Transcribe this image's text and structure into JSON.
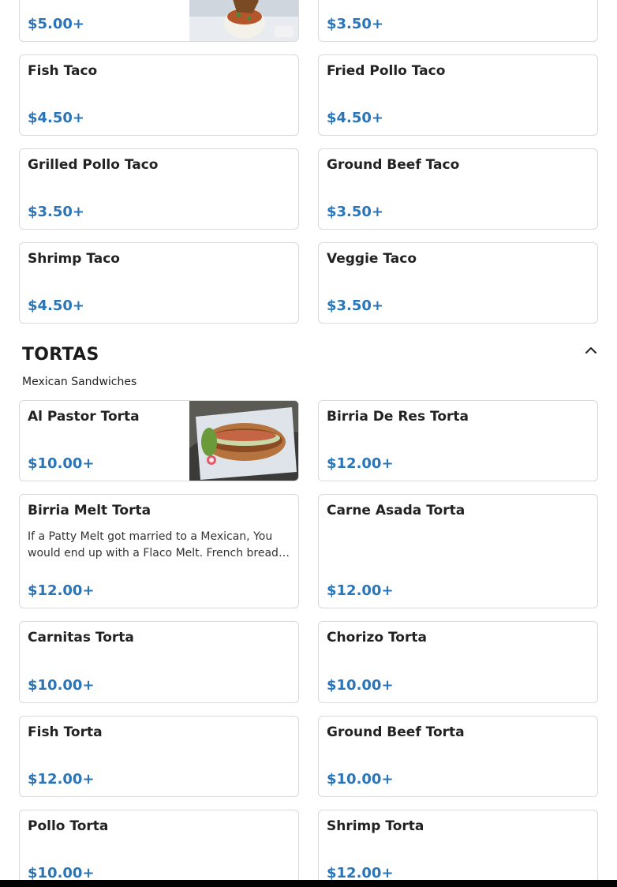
{
  "top_row": [
    {
      "price": "$5.00+"
    },
    {
      "price": "$3.50+"
    }
  ],
  "tacos": [
    {
      "name": "Fish Taco",
      "price": "$4.50+"
    },
    {
      "name": "Fried Pollo Taco",
      "price": "$4.50+"
    },
    {
      "name": "Grilled Pollo Taco",
      "price": "$3.50+"
    },
    {
      "name": "Ground Beef Taco",
      "price": "$3.50+"
    },
    {
      "name": "Shrimp Taco",
      "price": "$4.50+"
    },
    {
      "name": "Veggie Taco",
      "price": "$3.50+"
    }
  ],
  "tortas_section": {
    "title": "TORTAS",
    "subtitle": "Mexican Sandwiches",
    "collapse_icon": "chevron-up-icon"
  },
  "tortas": [
    {
      "name": "Al Pastor Torta",
      "price": "$10.00+",
      "has_image": true
    },
    {
      "name": "Birria De Res Torta",
      "price": "$12.00+"
    },
    {
      "name": "Birria Melt Torta",
      "description": "If a Patty Melt got married to a Mexican, You would end up with a Flaco Melt. French bread, Birria beef, melted cheese and grilled onions served with consomé.",
      "price": "$12.00+"
    },
    {
      "name": "Carne Asada Torta",
      "price": "$12.00+"
    },
    {
      "name": "Carnitas Torta",
      "price": "$10.00+"
    },
    {
      "name": "Chorizo Torta",
      "price": "$10.00+"
    },
    {
      "name": "Fish Torta",
      "price": "$12.00+"
    },
    {
      "name": "Ground Beef Torta",
      "price": "$10.00+"
    },
    {
      "name": "Pollo Torta",
      "price": "$10.00+"
    },
    {
      "name": "Shrimp Torta",
      "price": "$12.00+"
    }
  ],
  "colors": {
    "price": "#2a74b8",
    "border": "#d9d9d9"
  }
}
